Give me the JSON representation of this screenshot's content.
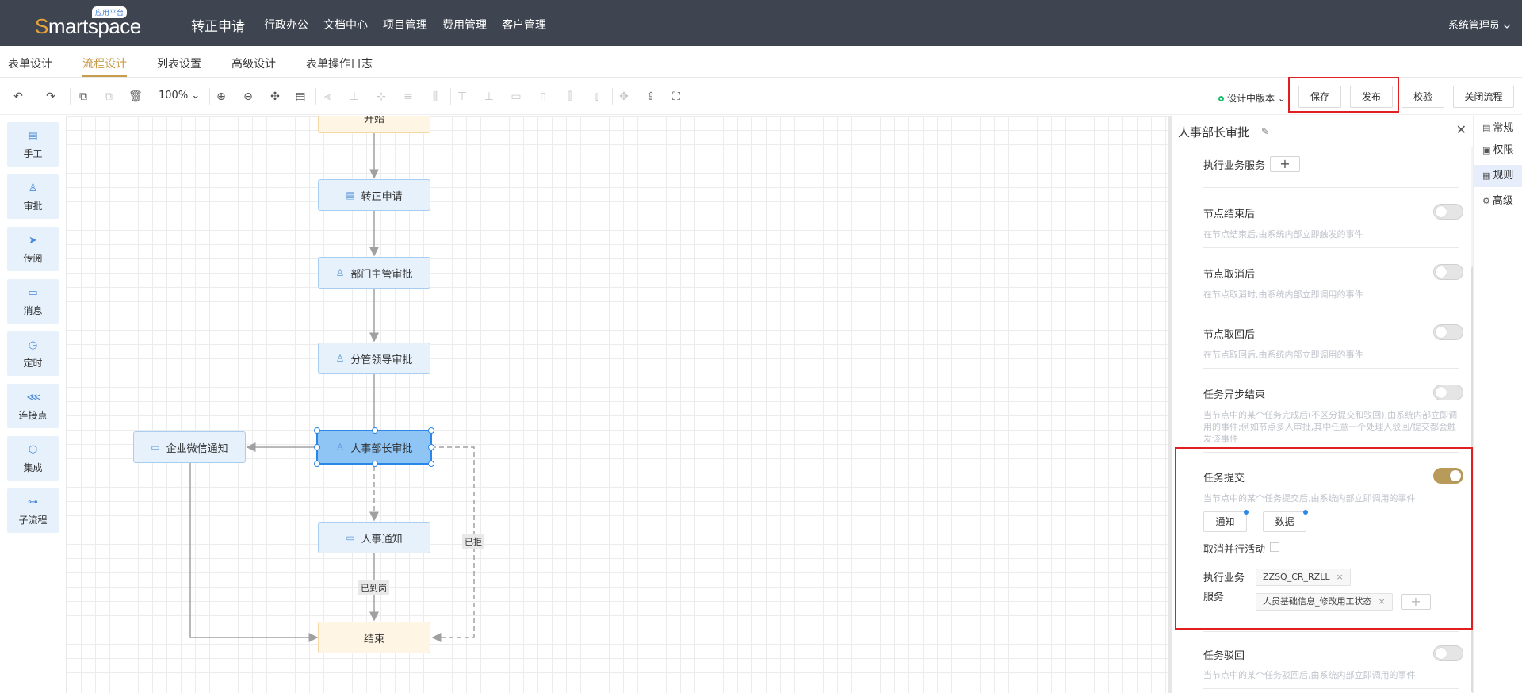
{
  "header": {
    "logo_text": "Smartspace",
    "logo_badge": "应用平台",
    "app_title": "转正申请",
    "nav": [
      "行政办公",
      "文档中心",
      "项目管理",
      "费用管理",
      "客户管理"
    ],
    "user": "系统管理员"
  },
  "tabs": [
    "表单设计",
    "流程设计",
    "列表设置",
    "高级设计",
    "表单操作日志"
  ],
  "active_tab": "流程设计",
  "toolbar": {
    "zoom": "100%",
    "version": "设计中版本",
    "buttons": {
      "save": "保存",
      "publish": "发布",
      "validate": "校验",
      "close": "关闭流程"
    }
  },
  "palette": [
    {
      "label": "手工",
      "icon": "form-icon"
    },
    {
      "label": "审批",
      "icon": "approver-icon"
    },
    {
      "label": "传阅",
      "icon": "send-icon"
    },
    {
      "label": "消息",
      "icon": "message-icon"
    },
    {
      "label": "定时",
      "icon": "clock-icon"
    },
    {
      "label": "连接点",
      "icon": "share-icon"
    },
    {
      "label": "集成",
      "icon": "cube-icon"
    },
    {
      "label": "子流程",
      "icon": "subflow-icon"
    }
  ],
  "flow": {
    "nodes": {
      "start": "开始",
      "apply": "转正申请",
      "dept_manager": "部门主管审批",
      "leader": "分管领导审批",
      "hr_head": "人事部长审批",
      "wechat": "企业微信通知",
      "hr_notice": "人事通知",
      "end": "结束"
    },
    "edge_labels": {
      "rejected": "已拒",
      "arrived": "已到岗"
    }
  },
  "panel": {
    "title": "人事部长审批",
    "exec_service_label": "执行业务服务",
    "rows": [
      {
        "label": "节点结束后",
        "desc": "在节点结束后,由系统内部立即触发的事件",
        "on": false
      },
      {
        "label": "节点取消后",
        "desc": "在节点取消时,由系统内部立即调用的事件",
        "on": false
      },
      {
        "label": "节点取回后",
        "desc": "在节点取回后,由系统内部立即调用的事件",
        "on": false
      },
      {
        "label": "任务异步结束",
        "desc": "当节点中的某个任务完成后(不区分提交和驳回),由系统内部立即调用的事件;例如节点多人审批,其中任意一个处理人驳回/提交都会触发该事件",
        "on": false
      }
    ],
    "submit": {
      "label": "任务提交",
      "desc": "当节点中的某个任务提交后,由系统内部立即调用的事件",
      "on": true,
      "notify_btn": "通知",
      "data_btn": "数据",
      "cancel_parallel": "取消并行活动",
      "exec_label_1": "执行业务",
      "exec_label_2": "服务",
      "tags": [
        "ZZSQ_CR_RZLL",
        "人员基础信息_修改用工状态"
      ]
    },
    "reject": {
      "label": "任务驳回",
      "desc": "当节点中的某个任务驳回后,由系统内部立即调用的事件",
      "on": false
    }
  },
  "side_tabs": [
    {
      "label": "常规",
      "icon": "doc-icon"
    },
    {
      "label": "权限",
      "icon": "lock-icon"
    },
    {
      "label": "规则",
      "icon": "rule-icon"
    },
    {
      "label": "高级",
      "icon": "gear-icon"
    }
  ],
  "active_side_tab": "规则",
  "colors": {
    "header_bg": "#3e4450",
    "accent": "#c89c4a",
    "highlight": "#e02020",
    "node_bg": "#e6f1fb",
    "selected_node": "#8ec5f5"
  }
}
